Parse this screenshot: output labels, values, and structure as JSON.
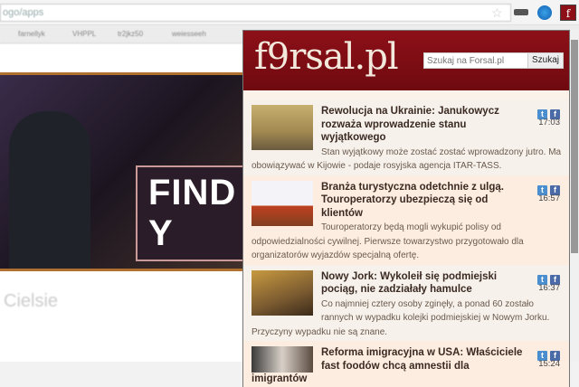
{
  "browser": {
    "url": "ogo/apps",
    "bookmarks": [
      "farnellyk",
      "VHPPL",
      "tr2jkz50",
      "weiesseeh"
    ]
  },
  "background_page": {
    "banner_text": "FIND Y",
    "below_text": "Cielsie"
  },
  "popup": {
    "logo": "f9rsal.pl",
    "search": {
      "placeholder": "Szukaj na Forsal.pl",
      "button": "Szukaj"
    },
    "articles": [
      {
        "title": "Rewolucja na Ukrainie: Janukowycz rozważa wprowadzenie stanu wyjątkowego",
        "time": "17:03",
        "desc": "Stan wyjątkowy może zostać zostać wprowadzony jutro. Ma obowiązywać w Kijowie - podaje rosyjska agencja ITAR-TASS."
      },
      {
        "title": "Branża turystyczna odetchnie z ulgą. Touroperatorzy ubezpieczą się od klientów",
        "time": "16:57",
        "desc": "Touroperatorzy będą mogli wykupić polisy od odpowiedzialności cywilnej. Pierwsze towarzystwo przygotowało dla organizatorów wyjazdów specjalną ofertę."
      },
      {
        "title": "Nowy Jork: Wykoleił się podmiejski pociąg, nie zadziałały hamulce",
        "time": "16:37",
        "desc": "Co najmniej cztery osoby zginęły, a ponad 60 zostało rannych w wypadku kolejki podmiejskiej w Nowym Jorku. Przyczyny wypadku nie są znane."
      },
      {
        "title": "Reforma imigracyjna w USA: Właściciele fast foodów chcą amnestii dla imigrantów",
        "time": "15:24",
        "desc": ""
      }
    ]
  }
}
